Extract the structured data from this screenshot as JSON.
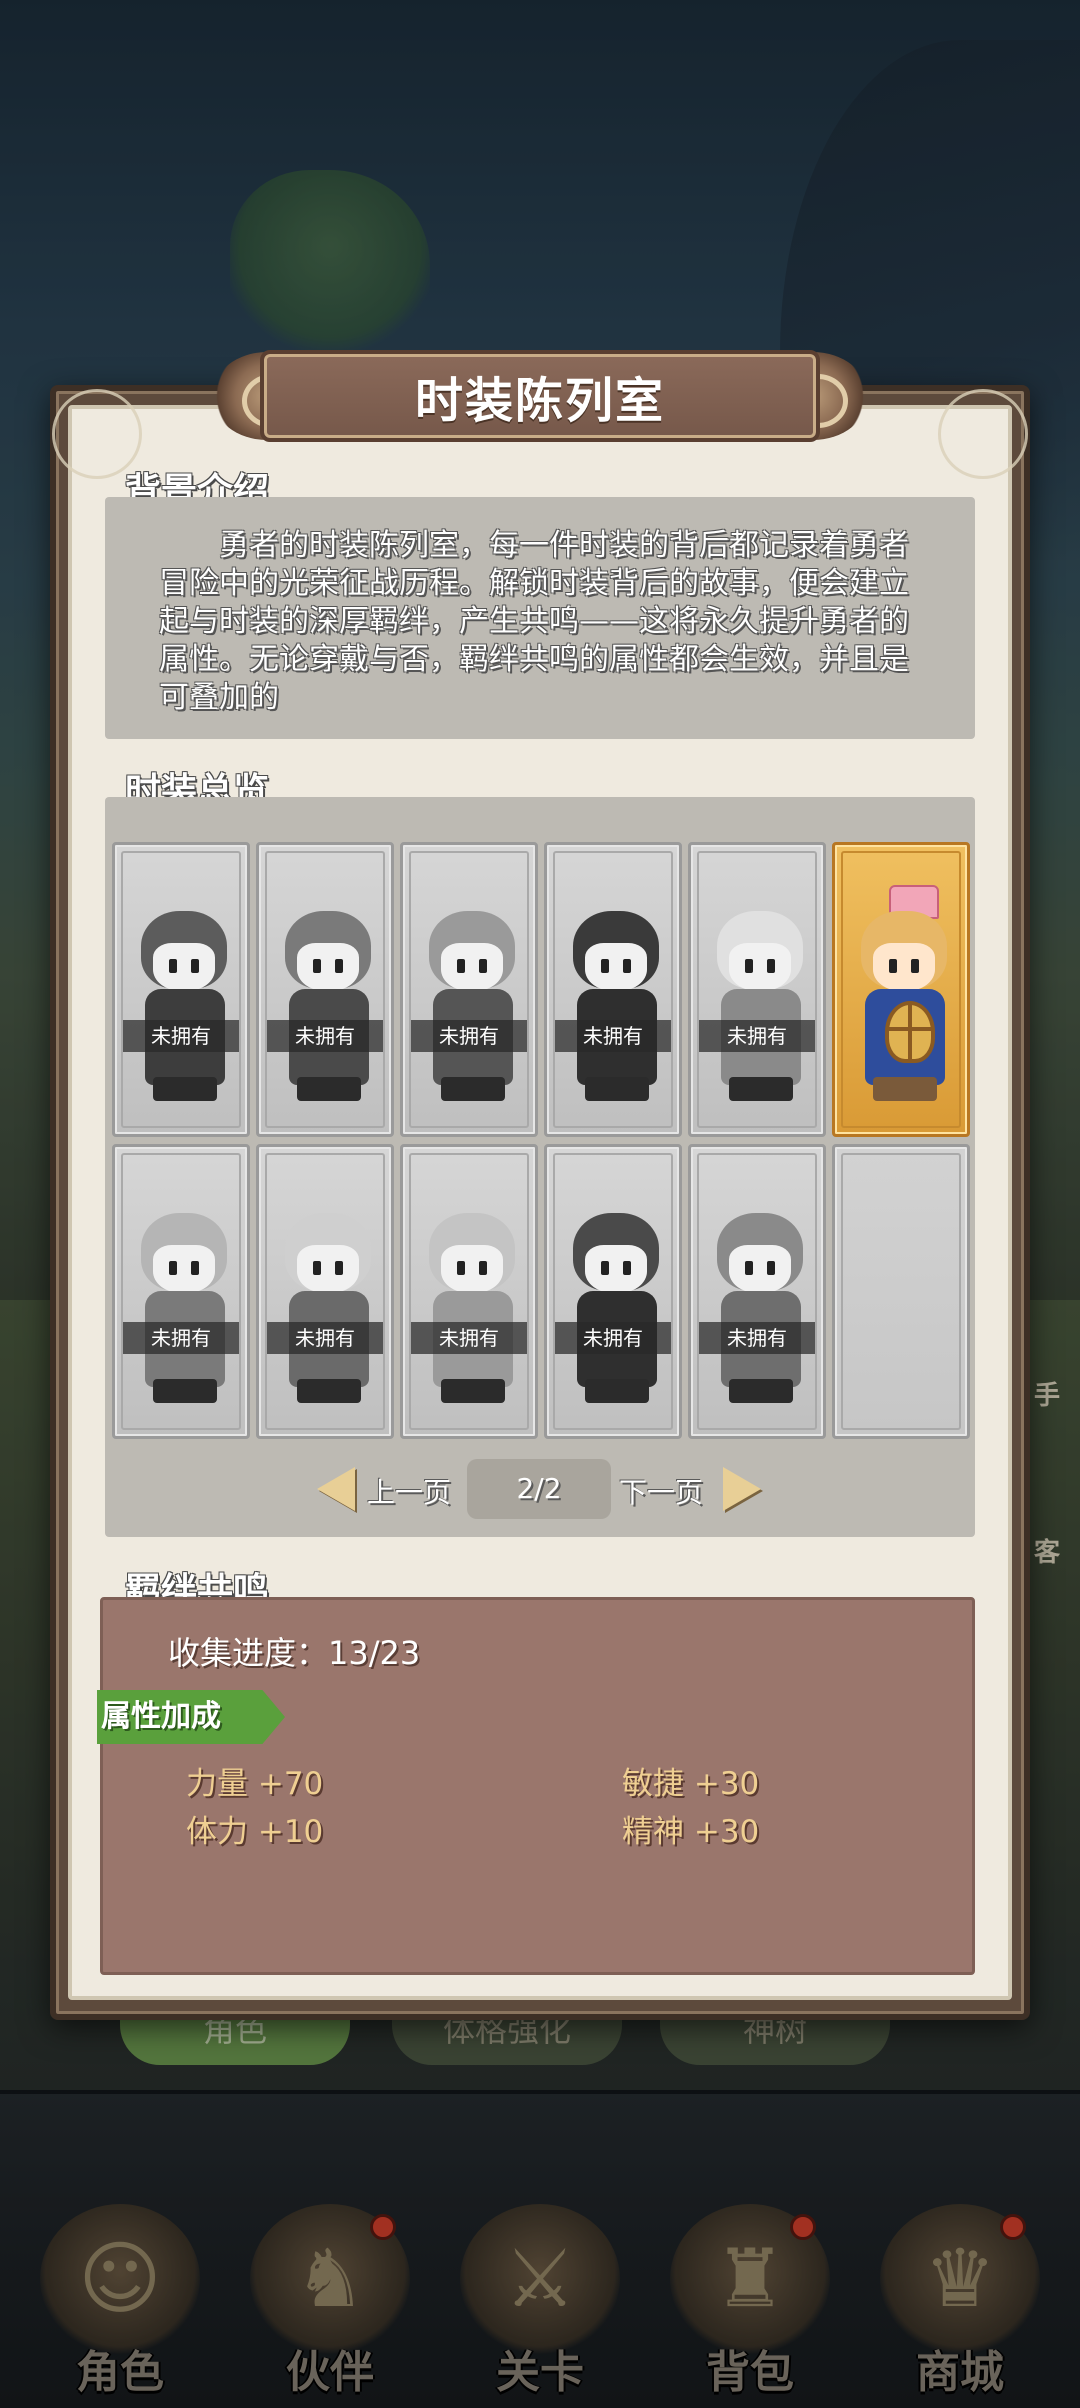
{
  "dialog": {
    "title": "时装陈列室",
    "background_section": {
      "heading": "背景介绍",
      "text": "勇者的时装陈列室，每一件时装的背后都记录着勇者冒险中的光荣征战历程。解锁时装背后的故事，便会建立起与时装的深厚羁绊，产生共鸣——这将永久提升勇者的属性。无论穿戴与否，羁绊共鸣的属性都会生效，并且是可叠加的"
    },
    "overview_section": {
      "heading": "时装总览",
      "costumes": [
        {
          "status": "未拥有",
          "owned": false
        },
        {
          "status": "未拥有",
          "owned": false
        },
        {
          "status": "未拥有",
          "owned": false
        },
        {
          "status": "未拥有",
          "owned": false
        },
        {
          "status": "未拥有",
          "owned": false
        },
        {
          "status": "",
          "owned": true
        },
        {
          "status": "未拥有",
          "owned": false
        },
        {
          "status": "未拥有",
          "owned": false
        },
        {
          "status": "未拥有",
          "owned": false
        },
        {
          "status": "未拥有",
          "owned": false
        },
        {
          "status": "未拥有",
          "owned": false
        },
        {
          "status": "",
          "owned": false,
          "empty": true
        }
      ],
      "pager": {
        "prev_label": "上一页",
        "next_label": "下一页",
        "current_page": "2/2"
      }
    },
    "bond_section": {
      "heading": "羁绊共鸣",
      "progress_label": "收集进度：13/23",
      "attr_ribbon": "属性加成",
      "attributes": [
        {
          "text": "力量 +70"
        },
        {
          "text": "敏捷 +30"
        },
        {
          "text": "体力 +10"
        },
        {
          "text": "精神 +30"
        }
      ]
    }
  },
  "background_tabs": [
    "角色",
    "体格强化",
    "神树"
  ],
  "side_labels": [
    "手",
    "客"
  ],
  "bottom_nav": [
    {
      "label": "角色",
      "icon": "hero-portrait-icon",
      "badge": false
    },
    {
      "label": "伙伴",
      "icon": "knight-helmet-icon",
      "badge": true
    },
    {
      "label": "关卡",
      "icon": "crossed-swords-icon",
      "badge": false
    },
    {
      "label": "背包",
      "icon": "backpack-icon",
      "badge": true
    },
    {
      "label": "商城",
      "icon": "treasure-chest-icon",
      "badge": true
    }
  ],
  "colors": {
    "owned_card": "#d99a35",
    "attr_ribbon": "#5aa03c",
    "bond_panel": "#9a766c",
    "notification_dot": "#d9402c"
  }
}
